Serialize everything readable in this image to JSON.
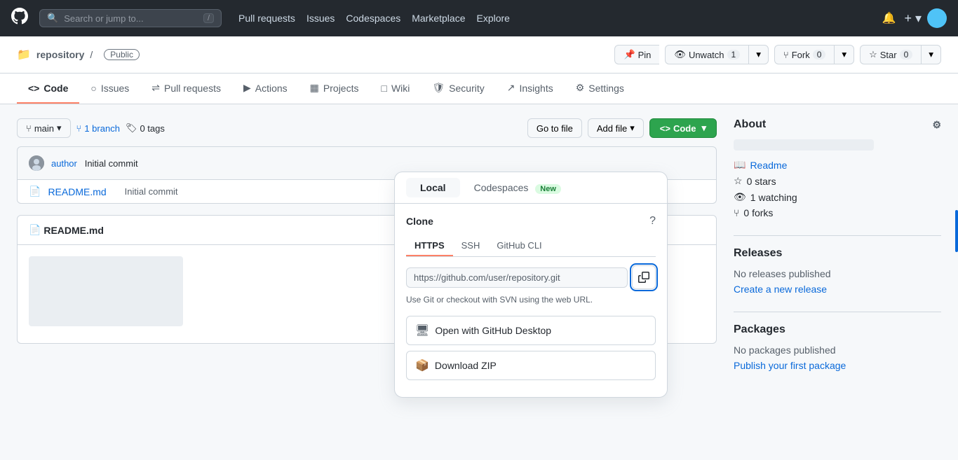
{
  "topnav": {
    "logo": "⬤",
    "search_placeholder": "Search or jump to...",
    "slash_key": "/",
    "links": [
      "Pull requests",
      "Issues",
      "Codespaces",
      "Marketplace",
      "Explore"
    ],
    "notification_icon": "🔔",
    "plus_icon": "+",
    "avatar_color": "#4fc3f7"
  },
  "repo_header": {
    "repo_breadcrumb": "",
    "repo_name": "repository",
    "public_label": "Public",
    "pin_label": "Pin",
    "unwatch_label": "Unwatch",
    "unwatch_count": "1",
    "fork_label": "Fork",
    "fork_count": "0",
    "star_label": "Star",
    "star_count": "0"
  },
  "tabs": [
    {
      "icon": "<>",
      "label": "Code",
      "active": true
    },
    {
      "icon": "○",
      "label": "Issues",
      "active": false
    },
    {
      "icon": "⇌",
      "label": "Pull requests",
      "active": false
    },
    {
      "icon": "▶",
      "label": "Actions",
      "active": false
    },
    {
      "icon": "▦",
      "label": "Projects",
      "active": false
    },
    {
      "icon": "□",
      "label": "Wiki",
      "active": false
    },
    {
      "icon": "⛉",
      "label": "Security",
      "active": false
    },
    {
      "icon": "↗",
      "label": "Insights",
      "active": false
    },
    {
      "icon": "⚙",
      "label": "Settings",
      "active": false
    }
  ],
  "branch_bar": {
    "branch_name": "main",
    "branch_count": "1 branch",
    "tag_count": "0 tags",
    "go_to_file": "Go to file",
    "add_file": "Add file",
    "code_btn": "Code"
  },
  "commit_info": {
    "message": "Initial commit",
    "time_ago": ""
  },
  "files": [
    {
      "name": "README.md",
      "commit": "Initial commit",
      "time": ""
    }
  ],
  "readme": {
    "title": "README.md",
    "placeholder": true
  },
  "code_dropdown": {
    "tab_local": "Local",
    "tab_codespaces": "Codespaces",
    "new_badge": "New",
    "clone_title": "Clone",
    "clone_tabs": [
      "HTTPS",
      "SSH",
      "GitHub CLI"
    ],
    "active_clone_tab": "HTTPS",
    "url_placeholder": "https://github.com/...",
    "url_hint": "Use Git or checkout with SVN using the web URL.",
    "open_desktop_label": "Open with GitHub Desktop",
    "download_zip_label": "Download ZIP"
  },
  "sidebar": {
    "about_title": "About",
    "desc_placeholder": true,
    "readme_label": "Readme",
    "stars_label": "0 stars",
    "watching_label": "1 watching",
    "forks_label": "0 forks",
    "releases_title": "Releases",
    "no_releases": "No releases published",
    "create_release": "Create a new release",
    "packages_title": "Packages",
    "no_packages": "No packages published",
    "publish_package": "Publish your first package"
  }
}
